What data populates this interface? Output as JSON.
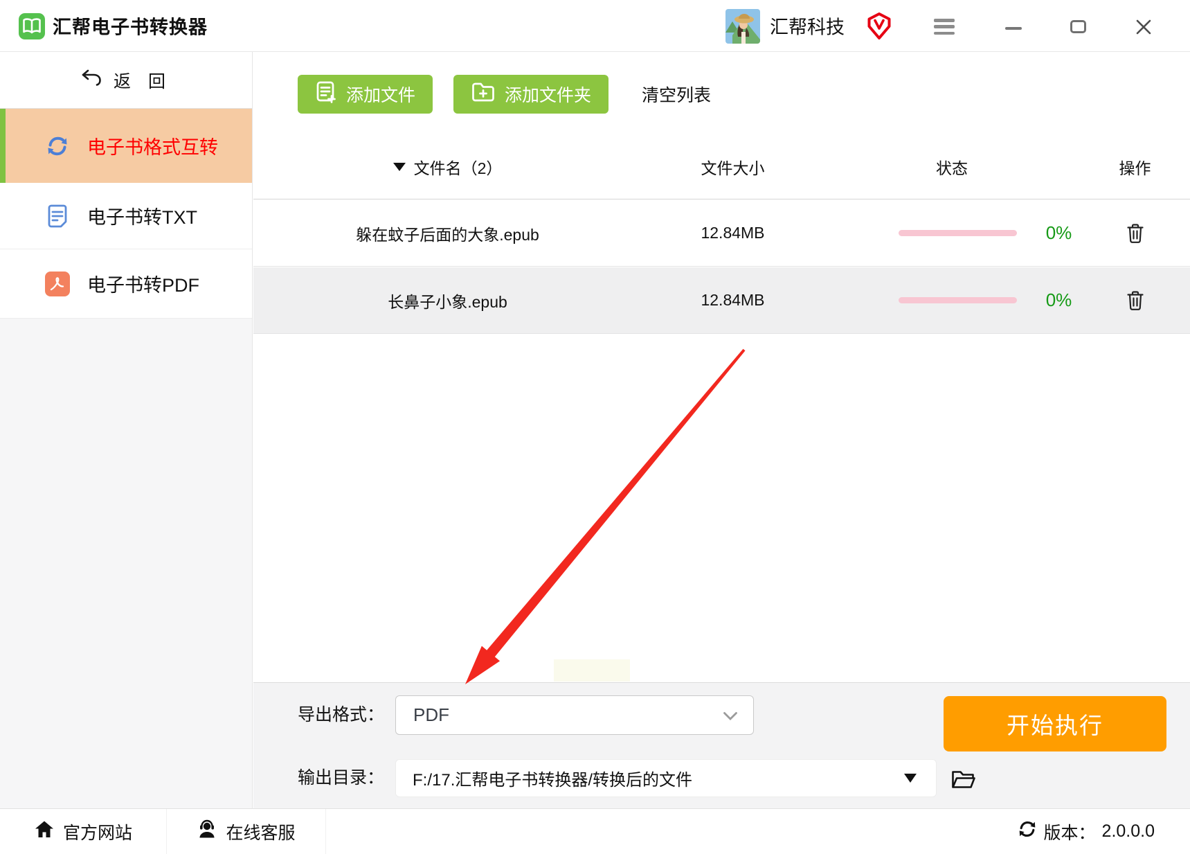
{
  "titlebar": {
    "app_title": "汇帮电子书转换器",
    "account_name": "汇帮科技"
  },
  "sidebar": {
    "back_label": "返 回",
    "items": [
      {
        "label": "电子书格式互转",
        "icon": "sync-icon",
        "active": true
      },
      {
        "label": "电子书转TXT",
        "icon": "txt-document-icon",
        "active": false
      },
      {
        "label": "电子书转PDF",
        "icon": "pdf-icon",
        "active": false
      }
    ]
  },
  "toolbar": {
    "add_file_label": "添加文件",
    "add_folder_label": "添加文件夹",
    "clear_list_label": "清空列表"
  },
  "table": {
    "header": {
      "name": "文件名（2）",
      "size": "文件大小",
      "status": "状态",
      "action": "操作"
    },
    "rows": [
      {
        "name": "躲在蚊子后面的大象.epub",
        "size": "12.84MB",
        "progress_percent": "0%"
      },
      {
        "name": "长鼻子小象.epub",
        "size": "12.84MB",
        "progress_percent": "0%"
      }
    ]
  },
  "controls": {
    "export_format_label": "导出格式：",
    "export_format_value": "PDF",
    "output_dir_label": "输出目录：",
    "output_dir_value": "F:/17.汇帮电子书转换器/转换后的文件",
    "start_button_label": "开始执行"
  },
  "footer": {
    "website_label": "官方网站",
    "support_label": "在线客服",
    "version_label": "版本：",
    "version_value": "2.0.0.0"
  },
  "colors": {
    "primary_green": "#8cc540",
    "logo_green": "#55c14e",
    "sidebar_active_bg": "#f6cba3",
    "sidebar_active_text": "#fe0000",
    "sidebar_active_bar": "#7fc242",
    "progress_pink": "#f8c6d2",
    "percent_green": "#169a16",
    "start_orange": "#ff9d00",
    "vip_red": "#e60113",
    "annotation_arrow_red": "#f2281f",
    "pdf_icon_orange": "#f3815e",
    "txt_icon_blue": "#5b8bd8"
  },
  "icons": {
    "logo": "book-icon",
    "account_badge": "vip-badge-icon",
    "window": [
      "menu-icon",
      "minimize-icon",
      "maximize-icon",
      "close-icon"
    ],
    "footer": [
      "home-icon",
      "headset-icon",
      "sync-icon"
    ]
  }
}
